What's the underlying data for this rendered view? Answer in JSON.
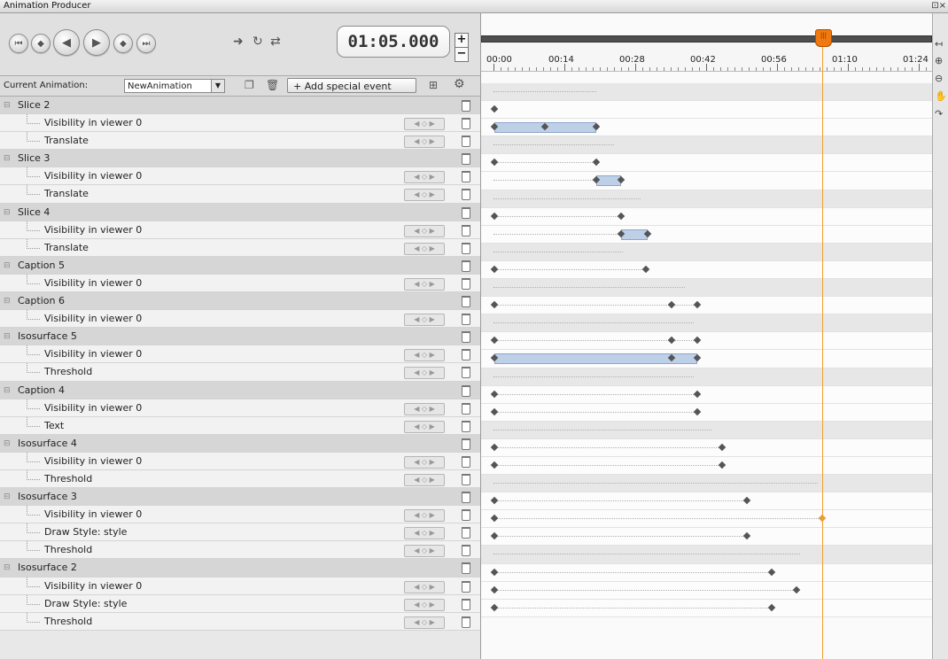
{
  "window": {
    "title": "Animation Producer",
    "controls": "⊡×"
  },
  "toolbar": {
    "time": "01:05.000",
    "plus": "+",
    "minus": "−",
    "current_animation_label": "Current Animation:",
    "current_animation_value": "NewAnimation",
    "add_event_label": "+ Add special event"
  },
  "timeline": {
    "labels": [
      "00:00",
      "00:14",
      "00:28",
      "00:42",
      "00:56",
      "01:10",
      "01:24"
    ]
  },
  "tracks": [
    {
      "type": "group",
      "name": "Slice 2"
    },
    {
      "type": "child",
      "name": "Visibility in viewer 0"
    },
    {
      "type": "child",
      "name": "Translate"
    },
    {
      "type": "group",
      "name": "Slice 3"
    },
    {
      "type": "child",
      "name": "Visibility in viewer 0"
    },
    {
      "type": "child",
      "name": "Translate"
    },
    {
      "type": "group",
      "name": "Slice 4"
    },
    {
      "type": "child",
      "name": "Visibility in viewer 0"
    },
    {
      "type": "child",
      "name": "Translate"
    },
    {
      "type": "group",
      "name": "Caption 5"
    },
    {
      "type": "child",
      "name": "Visibility in viewer 0"
    },
    {
      "type": "group",
      "name": "Caption 6"
    },
    {
      "type": "child",
      "name": "Visibility in viewer 0"
    },
    {
      "type": "group",
      "name": "Isosurface 5"
    },
    {
      "type": "child",
      "name": "Visibility in viewer 0"
    },
    {
      "type": "child",
      "name": "Threshold"
    },
    {
      "type": "group",
      "name": "Caption 4"
    },
    {
      "type": "child",
      "name": "Visibility in viewer 0"
    },
    {
      "type": "child",
      "name": "Text"
    },
    {
      "type": "group",
      "name": "Isosurface 4"
    },
    {
      "type": "child",
      "name": "Visibility in viewer 0"
    },
    {
      "type": "child",
      "name": "Threshold"
    },
    {
      "type": "group",
      "name": "Isosurface 3"
    },
    {
      "type": "child",
      "name": "Visibility in viewer 0"
    },
    {
      "type": "child",
      "name": "Draw Style: style"
    },
    {
      "type": "child",
      "name": "Threshold"
    },
    {
      "type": "group",
      "name": "Isosurface 2"
    },
    {
      "type": "child",
      "name": "Visibility in viewer 0"
    },
    {
      "type": "child",
      "name": "Draw Style: style"
    },
    {
      "type": "child",
      "name": "Threshold"
    }
  ]
}
